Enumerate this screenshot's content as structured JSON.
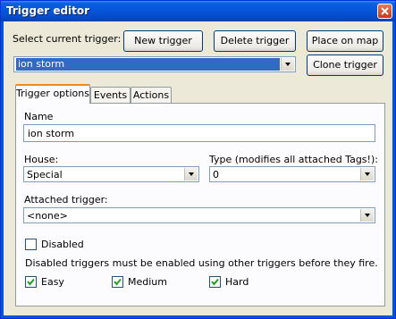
{
  "window": {
    "title": "Trigger editor"
  },
  "top": {
    "select_label": "Select current trigger:",
    "new_button": "New trigger",
    "delete_button": "Delete trigger",
    "place_button": "Place on map",
    "clone_button": "Clone trigger",
    "current_trigger": "ion storm"
  },
  "tabs": [
    {
      "label": "Trigger options",
      "active": true
    },
    {
      "label": "Events",
      "active": false
    },
    {
      "label": "Actions",
      "active": false
    }
  ],
  "options": {
    "name_label": "Name",
    "name_value": "ion storm",
    "house_label": "House:",
    "house_value": "Special",
    "type_label": "Type (modifies all attached Tags!):",
    "type_value": "0",
    "attached_label": "Attached trigger:",
    "attached_value": "<none>",
    "disabled_label": "Disabled",
    "disabled_checked": false,
    "disabled_note": "Disabled triggers must be enabled using other triggers before they fire.",
    "easy_label": "Easy",
    "easy_checked": true,
    "medium_label": "Medium",
    "medium_checked": true,
    "hard_label": "Hard",
    "hard_checked": true
  }
}
